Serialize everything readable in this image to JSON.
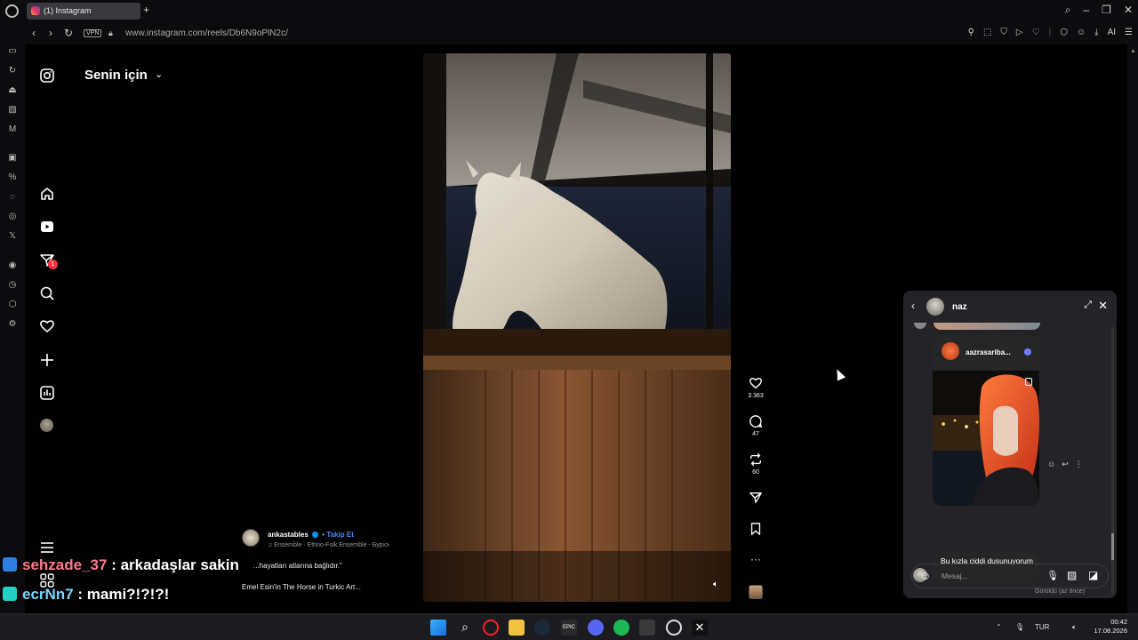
{
  "browser": {
    "tab_title": "(1) Instagram",
    "new_tab": "+",
    "url": "www.instagram.com/reels/Db6N9oPlN2c/",
    "vpn_label": "VPN",
    "ai_label": "AI"
  },
  "instagram": {
    "feed_title": "Senin için",
    "dm_badge_count": "1",
    "reel": {
      "poster": "ankastables",
      "follow_label": "Takip Et",
      "music": "Ensemble · Ethno-Folk Ensemble - Бурхэ",
      "caption_line1": "...hayatları atlarına bağlıdır.”",
      "caption_line2": "Emel Esin'in The Horse in Turkic Art...",
      "likes": "3.363",
      "comments": "47",
      "reposts": "60"
    }
  },
  "dm": {
    "contact_name": "naz",
    "shared_post_user": "aazrasariba...",
    "message_text": "Bu kızla ciddi dusunuyorum",
    "seen_text": "Görüldü (az önce)",
    "composer_placeholder": "Mesaj..."
  },
  "stream_chat": [
    {
      "user": "sehzade_37",
      "message": ": arkadaşlar sakin"
    },
    {
      "user": "ecrNn7",
      "message": ": mami?!?!?!"
    }
  ],
  "taskbar": {
    "lang": "TUR",
    "time": "00:42",
    "date": "17.08.2026"
  },
  "colors": {
    "follow_blue": "#4a8df8",
    "badge_red": "#ff3040",
    "chat_user1": "#ff7a8a",
    "chat_user2": "#7ad7ff"
  }
}
